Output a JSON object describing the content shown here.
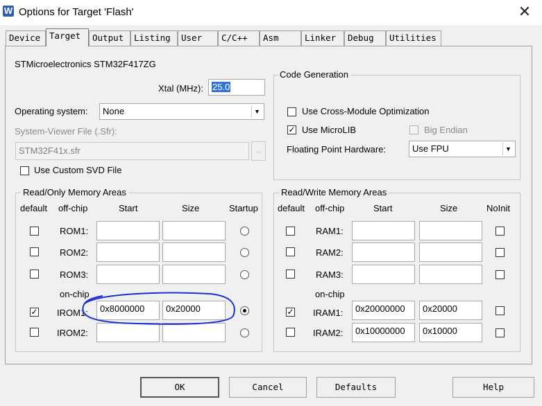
{
  "window": {
    "title": "Options for Target 'Flash'",
    "app_icon_glyph": "W",
    "close_glyph": "✕"
  },
  "tabs": [
    {
      "label": "Device"
    },
    {
      "label": "Target",
      "active": true
    },
    {
      "label": "Output"
    },
    {
      "label": "Listing"
    },
    {
      "label": "User"
    },
    {
      "label": "C/C++"
    },
    {
      "label": "Asm"
    },
    {
      "label": "Linker"
    },
    {
      "label": "Debug"
    },
    {
      "label": "Utilities"
    }
  ],
  "device_name": "STMicroelectronics STM32F417ZG",
  "xtal": {
    "label": "Xtal (MHz):",
    "value": "25.0"
  },
  "os": {
    "label": "Operating system:",
    "value": "None"
  },
  "sysviewer": {
    "label": "System-Viewer File (.Sfr):",
    "value": "STM32F41x.sfr",
    "browse": "..."
  },
  "custom_svd": {
    "label": "Use Custom SVD File",
    "checked": false
  },
  "codegen": {
    "title": "Code Generation",
    "cross_module": {
      "label": "Use Cross-Module Optimization",
      "checked": false
    },
    "microlib": {
      "label": "Use MicroLIB",
      "checked": true
    },
    "big_endian": {
      "label": "Big Endian",
      "checked": false,
      "disabled": true
    },
    "fpu_label": "Floating Point Hardware:",
    "fpu_value": "Use FPU"
  },
  "rom": {
    "title": "Read/Only Memory Areas",
    "headers": {
      "default": "default",
      "offchip": "off-chip",
      "start": "Start",
      "size": "Size",
      "startup": "Startup"
    },
    "onchip_label": "on-chip",
    "rows": [
      {
        "name": "ROM1:",
        "start": "",
        "size": "",
        "default": false,
        "startup": false
      },
      {
        "name": "ROM2:",
        "start": "",
        "size": "",
        "default": false,
        "startup": false
      },
      {
        "name": "ROM3:",
        "start": "",
        "size": "",
        "default": false,
        "startup": false
      },
      {
        "name": "IROM1:",
        "start": "0x8000000",
        "size": "0x20000",
        "default": true,
        "startup": true
      },
      {
        "name": "IROM2:",
        "start": "",
        "size": "",
        "default": false,
        "startup": false
      }
    ]
  },
  "ram": {
    "title": "Read/Write Memory Areas",
    "headers": {
      "default": "default",
      "offchip": "off-chip",
      "start": "Start",
      "size": "Size",
      "noinit": "NoInit"
    },
    "onchip_label": "on-chip",
    "rows": [
      {
        "name": "RAM1:",
        "start": "",
        "size": "",
        "default": false,
        "noinit": false
      },
      {
        "name": "RAM2:",
        "start": "",
        "size": "",
        "default": false,
        "noinit": false
      },
      {
        "name": "RAM3:",
        "start": "",
        "size": "",
        "default": false,
        "noinit": false
      },
      {
        "name": "IRAM1:",
        "start": "0x20000000",
        "size": "0x20000",
        "default": true,
        "noinit": false
      },
      {
        "name": "IRAM2:",
        "start": "0x10000000",
        "size": "0x10000",
        "default": false,
        "noinit": false
      }
    ]
  },
  "buttons": {
    "ok": "OK",
    "cancel": "Cancel",
    "defaults": "Defaults",
    "help": "Help"
  },
  "check_glyph": "✓",
  "colors": {
    "annotation": "#1a2fd6",
    "selection": "#3075d6"
  }
}
